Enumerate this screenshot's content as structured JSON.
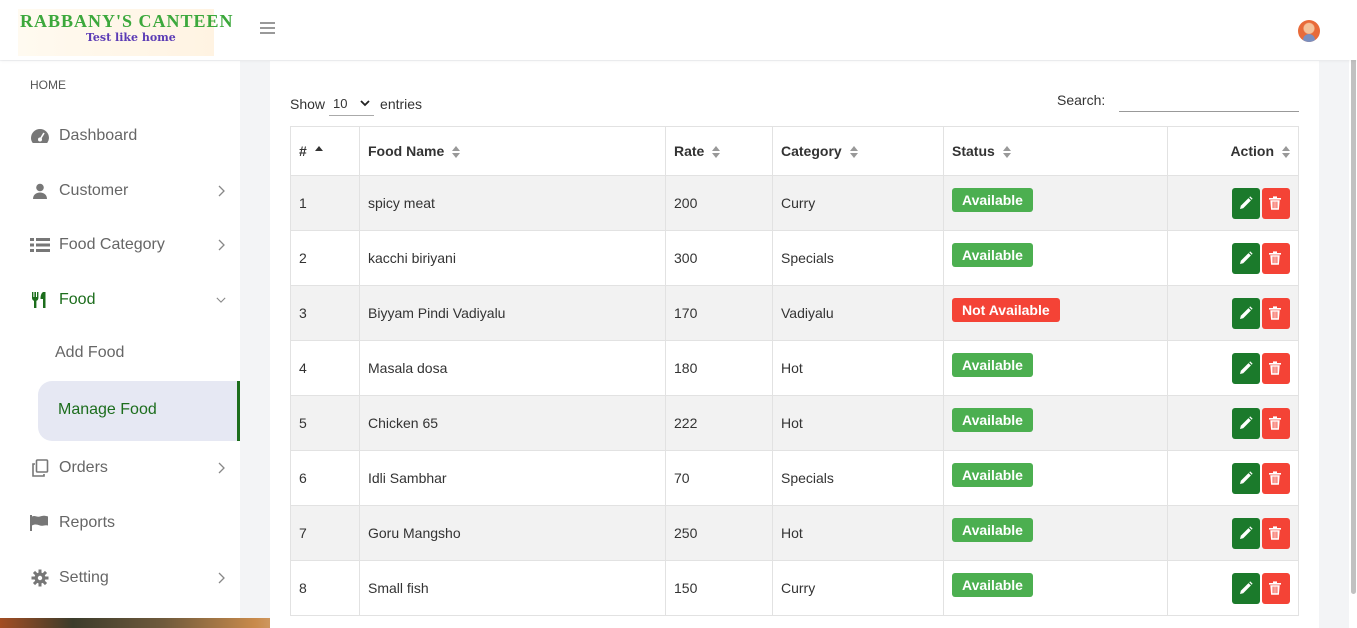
{
  "header": {
    "logo_title": "RABBANY'S CANTEEN",
    "logo_subtitle": "Test like home"
  },
  "sidebar": {
    "heading": "HOME",
    "items": [
      {
        "label": "Dashboard",
        "icon": "dashboard-icon"
      },
      {
        "label": "Customer",
        "icon": "user-icon"
      },
      {
        "label": "Food Category",
        "icon": "list-icon"
      },
      {
        "label": "Food",
        "icon": "utensils-icon"
      },
      {
        "label": "Orders",
        "icon": "copy-icon"
      },
      {
        "label": "Reports",
        "icon": "flag-icon"
      },
      {
        "label": "Setting",
        "icon": "gear-icon"
      }
    ],
    "food_submenu": {
      "add": "Add Food",
      "manage": "Manage Food"
    }
  },
  "table_controls": {
    "show_label": "Show",
    "entries_value": "10",
    "entries_label": "entries",
    "search_label": "Search:",
    "search_value": ""
  },
  "table": {
    "columns": [
      "#",
      "Food Name",
      "Rate",
      "Category",
      "Status",
      "Action"
    ],
    "rows": [
      {
        "id": "1",
        "name": "spicy meat",
        "rate": "200",
        "category": "Curry",
        "status": "Available"
      },
      {
        "id": "2",
        "name": "kacchi biriyani",
        "rate": "300",
        "category": "Specials",
        "status": "Available"
      },
      {
        "id": "3",
        "name": "Biyyam Pindi Vadiyalu",
        "rate": "170",
        "category": "Vadiyalu",
        "status": "Not Available"
      },
      {
        "id": "4",
        "name": "Masala dosa",
        "rate": "180",
        "category": "Hot",
        "status": "Available"
      },
      {
        "id": "5",
        "name": "Chicken 65",
        "rate": "222",
        "category": "Hot",
        "status": "Available"
      },
      {
        "id": "6",
        "name": "Idli Sambhar",
        "rate": "70",
        "category": "Specials",
        "status": "Available"
      },
      {
        "id": "7",
        "name": "Goru Mangsho",
        "rate": "250",
        "category": "Hot",
        "status": "Available"
      },
      {
        "id": "8",
        "name": "Small fish",
        "rate": "150",
        "category": "Curry",
        "status": "Available"
      }
    ]
  },
  "colors": {
    "accent": "#1c6d1c",
    "available": "#4caf50",
    "not_available": "#f44336",
    "edit_button": "#1b7a2b",
    "delete_button": "#f44336"
  }
}
